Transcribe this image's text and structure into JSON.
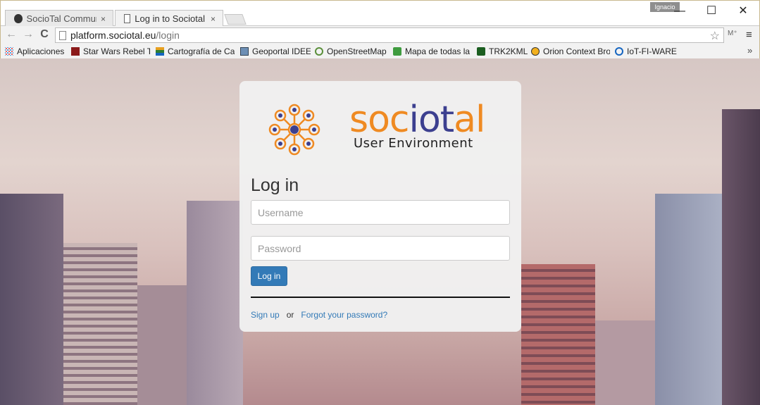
{
  "browser": {
    "tabs": [
      {
        "title": "SocioTal Communitie",
        "close": "×",
        "icon": "github-icon",
        "active": false
      },
      {
        "title": "Log in to Sociotal",
        "close": "×",
        "icon": "document-icon",
        "active": true
      }
    ],
    "user_chip": "Ignacio",
    "window": {
      "minimize": "—",
      "maximize": "☐",
      "close": "✕"
    },
    "nav": {
      "back": "←",
      "forward": "→",
      "reload": "C"
    },
    "url": {
      "host": "platform.sociotal.eu",
      "path": "/login"
    },
    "bookmarks": [
      {
        "label": "Aplicaciones",
        "icon": "apps-grid-icon"
      },
      {
        "label": "Star Wars Rebel T",
        "icon": "starwars-icon"
      },
      {
        "label": "Cartografía de Ca",
        "icon": "layers-icon"
      },
      {
        "label": "Geoportal IDEE",
        "icon": "geoportal-icon"
      },
      {
        "label": "OpenStreetMap",
        "icon": "magnifier-icon"
      },
      {
        "label": "Mapa de todas la",
        "icon": "map-green-icon"
      },
      {
        "label": "TRK2KML",
        "icon": "trk2kml-icon"
      },
      {
        "label": "Orion Context Bro",
        "icon": "orion-icon"
      },
      {
        "label": "IoT-FI-WARE",
        "icon": "iot-icon"
      }
    ],
    "bookmarks_more": "»"
  },
  "logo": {
    "word_left": "soc",
    "word_io": "iot",
    "word_right": "al",
    "subtitle": "User Environment"
  },
  "login": {
    "title": "Log in",
    "username_placeholder": "Username",
    "password_placeholder": "Password",
    "submit_label": "Log in",
    "signup_label": "Sign up",
    "or_text": "or",
    "forgot_label": "Forgot your password?"
  },
  "colors": {
    "brand_orange": "#ef8a22",
    "brand_navy": "#3c3f8f",
    "button_blue": "#337ab7"
  }
}
